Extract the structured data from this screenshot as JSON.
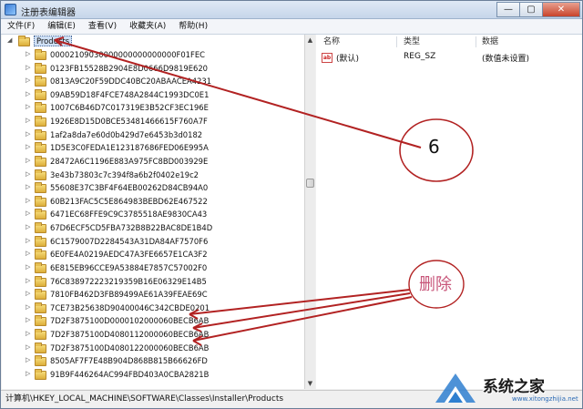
{
  "window": {
    "title": "注册表编辑器",
    "controls": [
      "—",
      "▢",
      "✕"
    ]
  },
  "menu": [
    "文件(F)",
    "编辑(E)",
    "查看(V)",
    "收藏夹(A)",
    "帮助(H)"
  ],
  "tree": {
    "root": "Products",
    "items": [
      "00002109030000000000000000F01FEC",
      "0123FB15528B2904E8D0666D9819E620",
      "0813A9C20F59DDC40BC20ABAACEA4231",
      "09AB59D18F4FCE748A2844C1993DC0E1",
      "1007C6B46D7C017319E3B52CF3EC196E",
      "1926E8D15D0BCE53481466615F760A7F",
      "1af2a8da7e60d0b429d7e6453b3d0182",
      "1D5E3C0FEDA1E123187686FED06E995A",
      "28472A6C1196E883A975FC8BD003929E",
      "3e43b73803c7c394f8a6b2f0402e19c2",
      "55608E37C3BF4F64EB00262D84CB94A0",
      "60B213FAC5C5E864983BEBD62E467522",
      "6471EC68FFE9C9C3785518AE9830CA43",
      "67D6ECF5CD5FBA732B8B22BAC8DE1B4D",
      "6C1579007D2284543A31DA84AF7570F6",
      "6E0FE4A0219AEDC47A3FE6657E1CA3F2",
      "6E815EB96CCE9A53884E7857C57002F0",
      "76C838972223219359B16E06329E14B5",
      "7810FB462D3FB89499AE61A39FEAE69C",
      "7CE73B25638D90400046C342CBDE0201",
      "7D2F3875100D0000102000060BECB6AB",
      "7D2F3875100D4080112000060BECB6AB",
      "7D2F3875100D4080122000060BECB6AB",
      "8505AF7F7E48B904D868B815B66626FD",
      "91B9F446264AC994FBD403A0CBA2821B"
    ]
  },
  "list": {
    "headers": [
      "名称",
      "类型",
      "数据"
    ],
    "rows": [
      {
        "icon": "ab",
        "name": "(默认)",
        "type": "REG_SZ",
        "data": "(数值未设置)"
      }
    ]
  },
  "status": "计算机\\HKEY_LOCAL_MACHINE\\SOFTWARE\\Classes\\Installer\\Products",
  "annotations": {
    "step_number": "6",
    "delete_label": "删除",
    "color_lines": "#b22222",
    "color_circle": "#b22222",
    "color_delete_text": "#c8567a"
  },
  "watermark": {
    "text": "系统之家",
    "url": "www.xitongzhijia.net"
  }
}
